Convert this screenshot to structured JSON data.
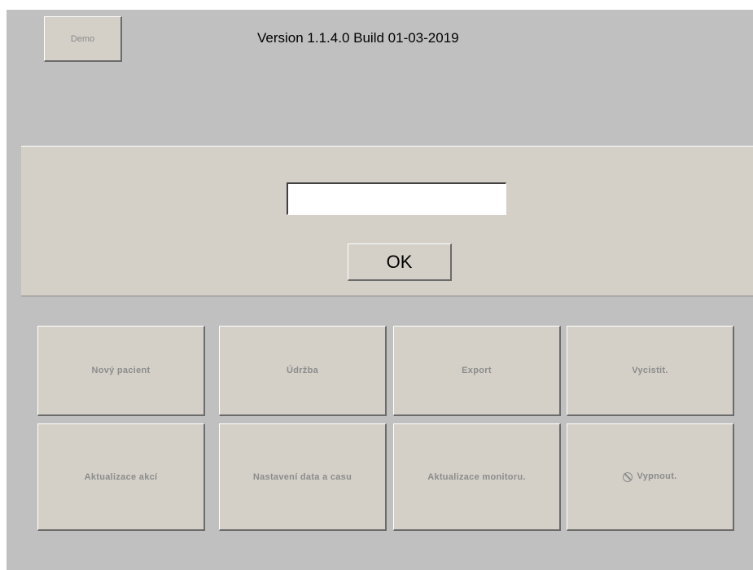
{
  "header": {
    "demo_label": "Demo",
    "version_text": "Version 1.1.4.0 Build 01-03-2019"
  },
  "login": {
    "password_value": "",
    "ok_label": "OK"
  },
  "actions": [
    {
      "label": "Nový pacient"
    },
    {
      "label": "Údržba"
    },
    {
      "label": "Export"
    },
    {
      "label": "Vycistit."
    },
    {
      "label": "Aktualizace akcí"
    },
    {
      "label": "Nastavení data a casu"
    },
    {
      "label": "Aktualizace monitoru."
    },
    {
      "label": "Vypnout.",
      "icon": "power-off-icon"
    }
  ],
  "colors": {
    "background": "#c0c0c0",
    "panel": "#d4d0c8",
    "disabled_text": "#8c8c8c"
  }
}
